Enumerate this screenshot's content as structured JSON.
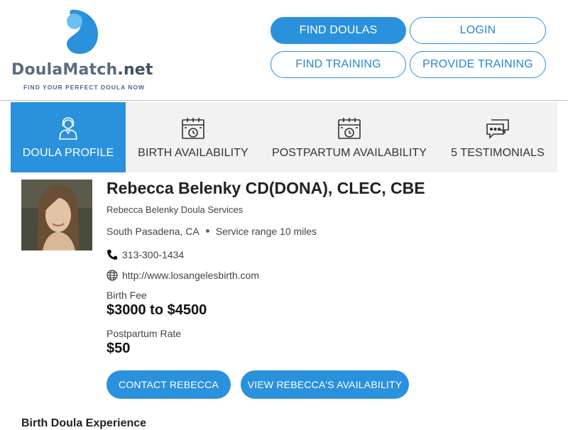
{
  "brand": {
    "name_main": "DoulaMatch",
    "name_tld": ".net",
    "tagline": "FIND YOUR PERFECT DOULA NOW",
    "colors": {
      "primary": "#2a91dd",
      "light": "#6ac0f2",
      "text": "#5a6b7d"
    }
  },
  "nav": {
    "find_doulas": "FIND DOULAS",
    "login": "LOGIN",
    "find_training": "FIND TRAINING",
    "provide_training": "PROVIDE TRAINING"
  },
  "tabs": [
    {
      "label": "DOULA PROFILE",
      "icon": "doula-person-icon",
      "active": true
    },
    {
      "label": "BIRTH AVAILABILITY",
      "icon": "calendar-clock-icon",
      "active": false
    },
    {
      "label": "POSTPARTUM AVAILABILITY",
      "icon": "calendar-clock-icon",
      "active": false
    },
    {
      "label": "5 TESTIMONIALS",
      "icon": "chat-bubbles-icon",
      "active": false
    }
  ],
  "profile": {
    "name": "Rebecca Belenky CD(DONA), CLEC, CBE",
    "business": "Rebecca Belenky Doula Services",
    "location": "South Pasadena, CA",
    "service_range": "Service range 10 miles",
    "phone": "313-300-1434",
    "website": "http://www.losangelesbirth.com",
    "birth_fee_label": "Birth Fee",
    "birth_fee": "$3000 to $4500",
    "postpartum_label": "Postpartum Rate",
    "postpartum_rate": "$50"
  },
  "actions": {
    "contact": "CONTACT REBECCA",
    "availability": "VIEW REBECCA'S AVAILABILITY"
  },
  "section": {
    "title": "Birth Doula Experience"
  }
}
